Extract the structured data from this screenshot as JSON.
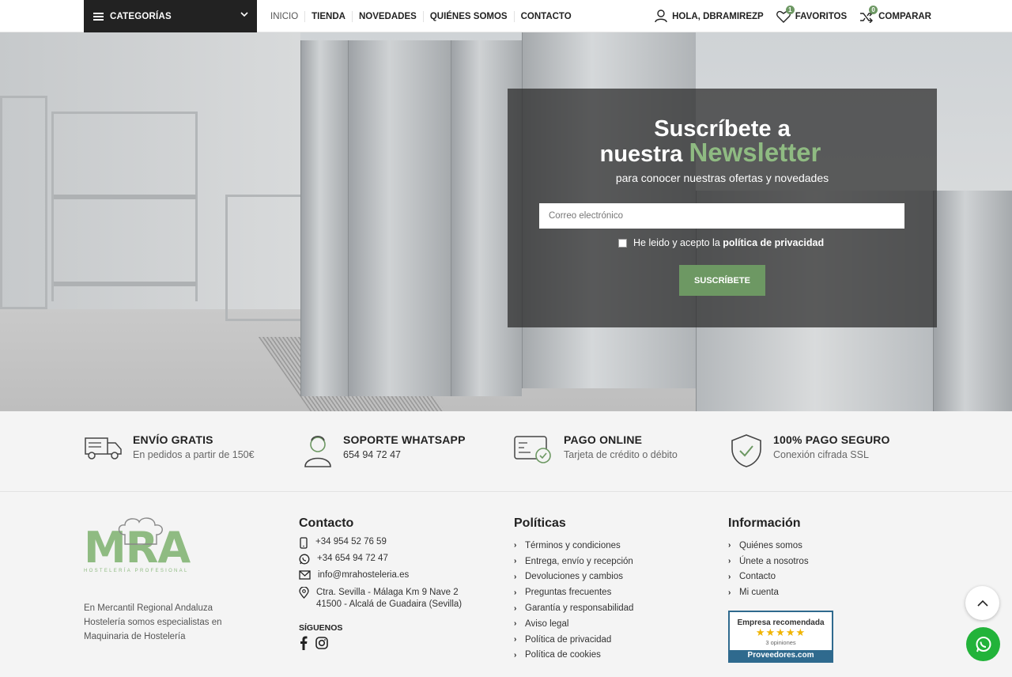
{
  "header": {
    "categories_label": "CATEGORÍAS",
    "nav": [
      "INICIO",
      "TIENDA",
      "NOVEDADES",
      "QUIÉNES SOMOS",
      "CONTACTO"
    ],
    "user_label": "HOLA, DBRAMIREZP",
    "favorites_label": "FAVORITOS",
    "favorites_count": "1",
    "compare_label": "COMPARAR",
    "compare_count": "0"
  },
  "newsletter": {
    "title_line1": "Suscríbete a",
    "title_line2_prefix": "nuestra",
    "title_line2_highlight": "Newsletter",
    "subtitle": "para conocer nuestras ofertas y novedades",
    "email_placeholder": "Correo electrónico",
    "consent_prefix": "He leido y acepto la",
    "consent_link": "política de privacidad",
    "button_label": "SUSCRÍBETE"
  },
  "features": [
    {
      "title": "ENVÍO GRATIS",
      "subtitle": "En pedidos a partir de 150€"
    },
    {
      "title": "SOPORTE WHATSAPP",
      "subtitle": "654 94 72 47"
    },
    {
      "title": "PAGO ONLINE",
      "subtitle": "Tarjeta de crédito o débito"
    },
    {
      "title": "100% PAGO SEGURO",
      "subtitle": "Conexión cifrada SSL"
    }
  ],
  "footer": {
    "logo_text": "MRA",
    "logo_tagline": "HOSTELERÍA PROFESIONAL",
    "about": "En Mercantil Regional Andaluza Hostelería somos especialistas en Maquinaria de Hostelería",
    "contact_title": "Contacto",
    "phone": "+34 954 52 76 59",
    "whatsapp": "+34 654 94 72 47",
    "email": "info@mrahosteleria.es",
    "address_line1": "Ctra. Sevilla - Málaga Km 9 Nave 2",
    "address_line2": "41500 - Alcalá de Guadaira (Sevilla)",
    "follow_label": "SÍGUENOS",
    "policies_title": "Políticas",
    "policies": [
      "Términos y condiciones",
      "Entrega, envío y recepción",
      "Devoluciones y cambios",
      "Preguntas frecuentes",
      "Garantía y responsabilidad",
      "Aviso legal",
      "Política de privacidad",
      "Política de cookies"
    ],
    "info_title": "Información",
    "info": [
      "Quiénes somos",
      "Únete a nosotros",
      "Contacto",
      "Mi cuenta"
    ],
    "badge_title": "Empresa recomendada",
    "badge_stars": "★★★★★",
    "badge_reviews": "3 opiniones",
    "badge_brand": "Proveedores.com"
  },
  "colors": {
    "accent": "#6d9863",
    "logo_green": "#8fbb82",
    "dark": "#222222",
    "whatsapp": "#22b33a"
  }
}
